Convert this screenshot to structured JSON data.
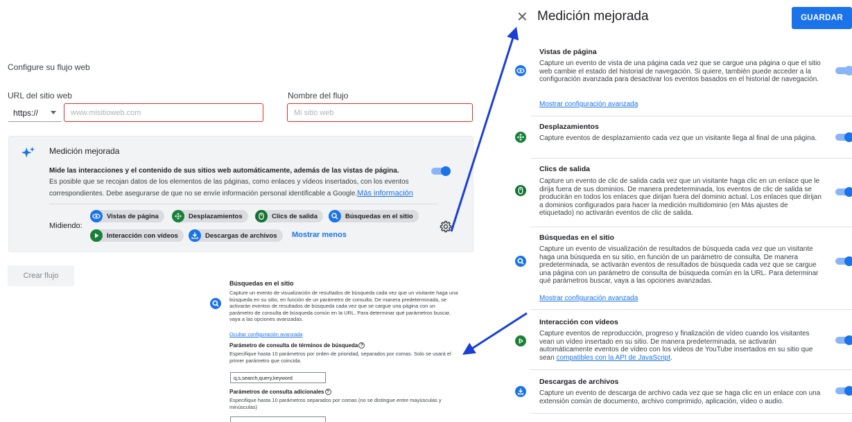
{
  "config": {
    "title": "Configure su flujo web",
    "url_label": "URL del sitio web",
    "protocol_value": "https://",
    "url_placeholder": "www.misitioweb.com",
    "name_label": "Nombre del flujo",
    "name_placeholder": "Mi sitio web",
    "create_button": "Crear flujo"
  },
  "enhanced_card": {
    "title": "Medición mejorada",
    "desc_bold": "Mide las interacciones y el contenido de sus sitios web automáticamente, además de las vistas de página.",
    "desc_rest": "Es posible que se recojan datos de los elementos de las páginas, como enlaces y vídeos insertados, con los eventos correspondientes. Debe asegurarse de que no se envíe información personal identificable a Google.",
    "more_info_link": "Más información",
    "toggle_on": true,
    "measuring_label": "Midiendo:",
    "chips": {
      "views": "Vistas de página",
      "scroll": "Desplazamientos",
      "outbound": "Clics de salida",
      "search": "Búsquedas en el sitio",
      "video": "Interacción con vídeos",
      "downloads": "Descargas de archivos"
    },
    "show_less": "Mostrar menos"
  },
  "site_search_detail": {
    "title": "Búsquedas en el sitio",
    "desc": "Capture un evento de visualización de resultados de búsqueda cada vez que un visitante haga una búsqueda en su sitio, en función de un parámetro de consulta. De manera predeterminada, se activarán eventos de resultados de búsqueda cada vez que se cargue una página con un parámetro de consulta de búsqueda común en la URL. Para determinar qué parámetros buscar, vaya a las opciones avanzadas.",
    "hide_link": "Ocultar configuración avanzada",
    "param1_title": "Parámetro de consulta de términos de búsqueda",
    "param1_desc": "Especifique hasta 10 parámetros por orden de prioridad, separados por comas. Solo se usará el primer parámetro que coincida.",
    "param1_value": "q,s,search,query,keyword",
    "param2_title": "Parámetros de consulta adicionales",
    "param2_desc": "Especifique hasta 10 parámetros separados por comas (no se distingue entre mayúsculas y minúsculas)",
    "param2_value": ""
  },
  "panel": {
    "title": "Medición mejorada",
    "save_button": "GUARDAR",
    "sections": {
      "views": {
        "title": "Vistas de página",
        "desc": "Capture un evento de vista de una página cada vez que se cargue una página o que el sitio web cambie el estado del historial de navegación. Si quiere, también puede acceder a la configuración avanzada para desactivar los eventos basados en el historial de navegación.",
        "link": "Mostrar configuración avanzada"
      },
      "scroll": {
        "title": "Desplazamientos",
        "desc": "Capture eventos de desplazamiento cada vez que un visitante llega al final de una página."
      },
      "outbound": {
        "title": "Clics de salida",
        "desc": "Capture un evento de clic de salida cada vez que un visitante haga clic en un enlace que le dirija fuera de sus dominios. De manera predeterminada, los eventos de clic de salida se producirán en todos los enlaces que dirijan fuera del dominio actual. Los enlaces que dirijan a dominios configurados para hacer la medición multidominio (en Más ajustes de etiquetado) no activarán eventos de clic de salida."
      },
      "search": {
        "title": "Búsquedas en el sitio",
        "desc": "Capture un evento de visualización de resultados de búsqueda cada vez que un visitante haga una búsqueda en su sitio, en función de un parámetro de consulta. De manera predeterminada, se activarán eventos de resultados de búsqueda cada vez que se cargue una página con un parámetro de consulta de búsqueda común en la URL. Para determinar qué parámetros buscar, vaya a las opciones avanzadas.",
        "link": "Mostrar configuración avanzada"
      },
      "video": {
        "title": "Interacción con vídeos",
        "desc": "Capture eventos de reproducción, progreso y finalización de vídeo cuando los visitantes vean un vídeo insertado en su sitio. De manera predeterminada, se activarán automáticamente eventos de vídeo con los vídeos de YouTube insertados en su sitio que sean",
        "desc_link": "compatibles con la API de JavaScript",
        "desc_end": "."
      },
      "downloads": {
        "title": "Descargas de archivos",
        "desc": "Capture un evento de descarga de archivo cada vez que se haga clic en un enlace con una extensión común de documento, archivo comprimido, aplicación, vídeo o audio."
      }
    }
  },
  "colors": {
    "accent": "#1a73e8",
    "error": "#d93025",
    "icon_views": "#1a73e8",
    "icon_scroll": "#188038",
    "icon_outbound": "#137333",
    "icon_search": "#1a73e8",
    "icon_video": "#188038",
    "icon_downloads": "#1a73e8",
    "arrow": "#1a3fd6"
  }
}
